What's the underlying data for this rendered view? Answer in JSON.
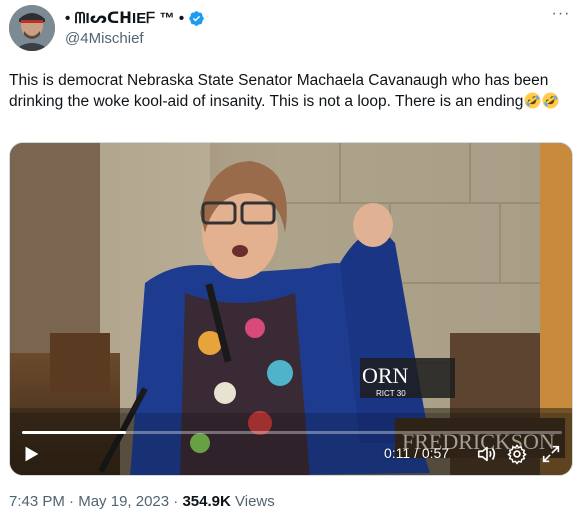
{
  "user": {
    "display_name": "• ᗰIᔕᑕᕼIEᖴ ™ •",
    "handle": "@4Mischief",
    "verified": true
  },
  "tweet": {
    "text": "This is democrat Nebraska State Senator Machaela Cavanaugh who has been drinking the woke kool-aid of insanity. This is not a loop. There is an ending",
    "emojis": [
      "rolling-on-floor-laughing",
      "rolling-on-floor-laughing"
    ]
  },
  "video": {
    "current_time": "0:11",
    "duration": "0:57",
    "time_display": "0:11 / 0:57",
    "progress": 0.193,
    "nameplate_top": "ORN",
    "nameplate_sub": "RICT 30",
    "nameplate_right": "FREDRICKSON"
  },
  "meta": {
    "time": "7:43 PM",
    "date": "May 19, 2023",
    "views_count": "354.9K",
    "views_label": "Views",
    "separator": "·"
  },
  "colors": {
    "text_primary": "#0f1419",
    "text_secondary": "#536471",
    "verified_blue": "#1d9bf0",
    "border": "#cfd9de"
  }
}
